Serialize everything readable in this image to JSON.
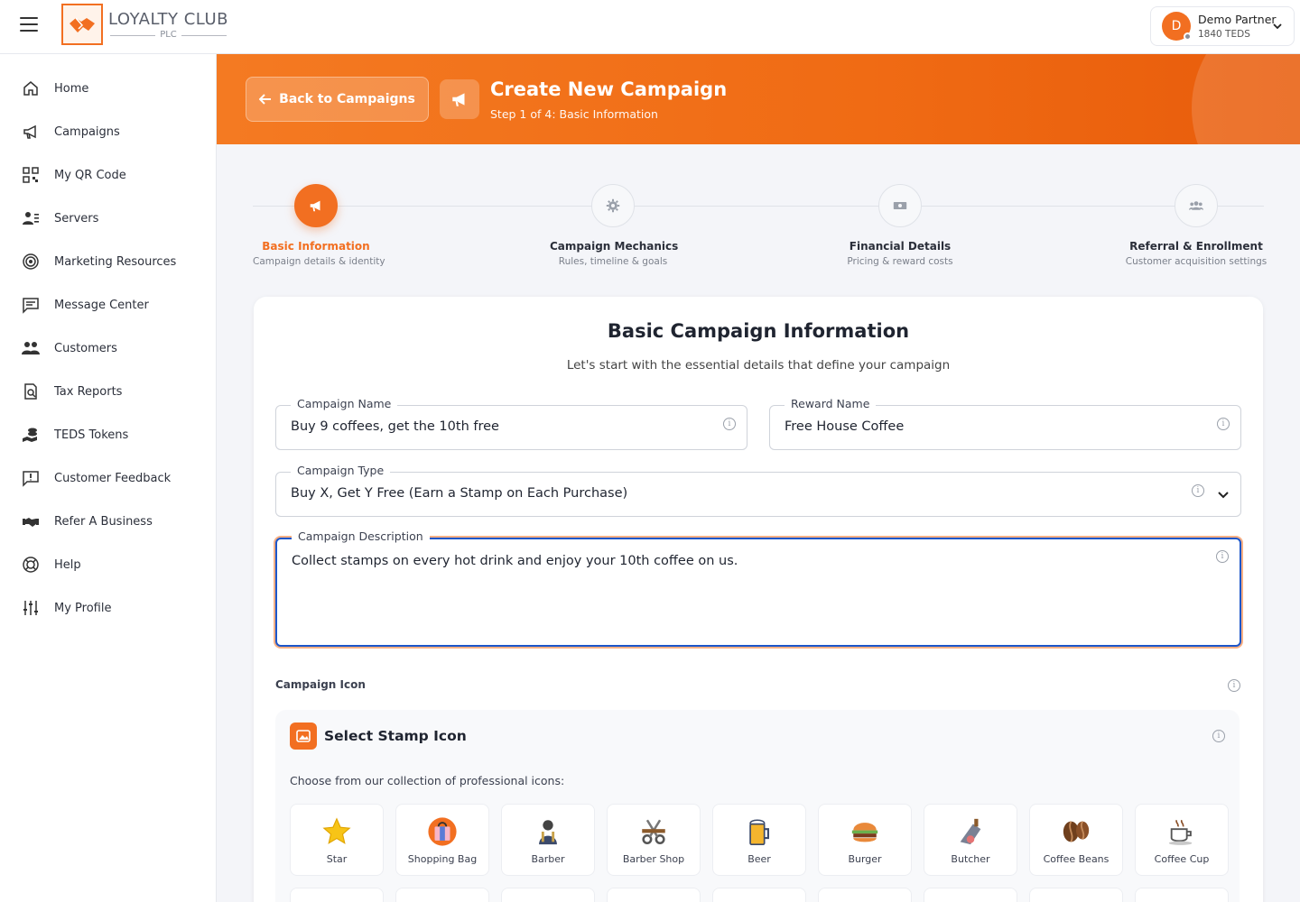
{
  "app": {
    "logo_name": "LOYALTY CLUB",
    "logo_sub": "PLC"
  },
  "user": {
    "initial": "D",
    "name": "Demo Partner",
    "teds": "1840 TEDS"
  },
  "sidebar": {
    "items": [
      {
        "label": "Home",
        "icon": "home-icon"
      },
      {
        "label": "Campaigns",
        "icon": "megaphone-icon"
      },
      {
        "label": "My QR Code",
        "icon": "qr-code-icon"
      },
      {
        "label": "Servers",
        "icon": "servers-icon"
      },
      {
        "label": "Marketing Resources",
        "icon": "target-icon"
      },
      {
        "label": "Message Center",
        "icon": "message-icon"
      },
      {
        "label": "Customers",
        "icon": "customers-icon"
      },
      {
        "label": "Tax Reports",
        "icon": "tax-report-icon"
      },
      {
        "label": "TEDS Tokens",
        "icon": "tokens-icon"
      },
      {
        "label": "Customer Feedback",
        "icon": "feedback-icon"
      },
      {
        "label": "Refer A Business",
        "icon": "handshake-icon"
      },
      {
        "label": "Help",
        "icon": "lifebuoy-icon"
      },
      {
        "label": "My Profile",
        "icon": "sliders-icon"
      }
    ]
  },
  "header": {
    "back_label": "Back to Campaigns",
    "title": "Create New Campaign",
    "subtitle": "Step 1 of 4: Basic Information"
  },
  "stepper": {
    "steps": [
      {
        "title": "Basic Information",
        "desc": "Campaign details & identity",
        "icon": "megaphone-icon",
        "active": true
      },
      {
        "title": "Campaign Mechanics",
        "desc": "Rules, timeline & goals",
        "icon": "gear-icon",
        "active": false
      },
      {
        "title": "Financial Details",
        "desc": "Pricing & reward costs",
        "icon": "money-icon",
        "active": false
      },
      {
        "title": "Referral & Enrollment",
        "desc": "Customer acquisition settings",
        "icon": "users-icon",
        "active": false
      }
    ]
  },
  "form": {
    "title": "Basic Campaign Information",
    "subtitle": "Let's start with the essential details that define your campaign",
    "campaign_name_label": "Campaign Name",
    "campaign_name_value": "Buy 9 coffees, get the 10th free",
    "reward_name_label": "Reward Name",
    "reward_name_value": "Free House Coffee",
    "campaign_type_label": "Campaign Type",
    "campaign_type_value": "Buy X, Get Y Free (Earn a Stamp on Each Purchase)",
    "description_label": "Campaign Description",
    "description_value": "Collect stamps on every hot drink and enjoy your 10th coffee on us.",
    "campaign_icon_label": "Campaign Icon"
  },
  "icon_panel": {
    "title": "Select Stamp Icon",
    "hint": "Choose from our collection of professional icons:",
    "stamps": [
      {
        "label": "Star",
        "icon": "star-icon"
      },
      {
        "label": "Shopping Bag",
        "icon": "shopping-bag-icon"
      },
      {
        "label": "Barber",
        "icon": "barber-icon"
      },
      {
        "label": "Barber Shop",
        "icon": "barber-shop-icon"
      },
      {
        "label": "Beer",
        "icon": "beer-icon"
      },
      {
        "label": "Burger",
        "icon": "burger-icon"
      },
      {
        "label": "Butcher",
        "icon": "butcher-icon"
      },
      {
        "label": "Coffee Beans",
        "icon": "coffee-beans-icon"
      },
      {
        "label": "Coffee Cup",
        "icon": "coffee-cup-icon"
      }
    ]
  },
  "colors": {
    "accent": "#f26f21",
    "focus": "#1c56c9"
  }
}
